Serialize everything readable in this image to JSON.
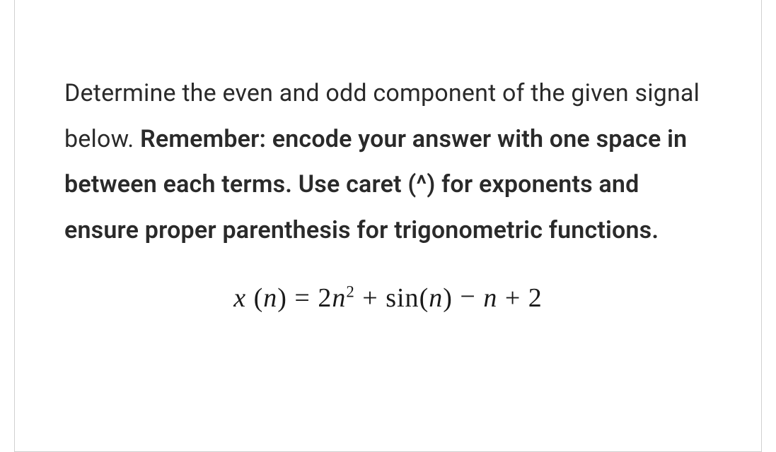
{
  "question": {
    "intro": "Determine the even and odd component of the given signal below. ",
    "bold": "Remember: encode your answer with one space in between each terms. Use caret (^) for exponents and ensure proper parenthesis for trigonometric functions."
  },
  "equation": {
    "lhs_var": "x",
    "lhs_arg": "n",
    "term1_coef": "2",
    "term1_var": "n",
    "term1_exp": "2",
    "op1": "+",
    "term2_func": "sin",
    "term2_arg": "n",
    "op2": "−",
    "term3": "n",
    "op3": "+",
    "term4": "2",
    "plain": "x (n) = 2n^2 + sin(n) − n + 2"
  }
}
